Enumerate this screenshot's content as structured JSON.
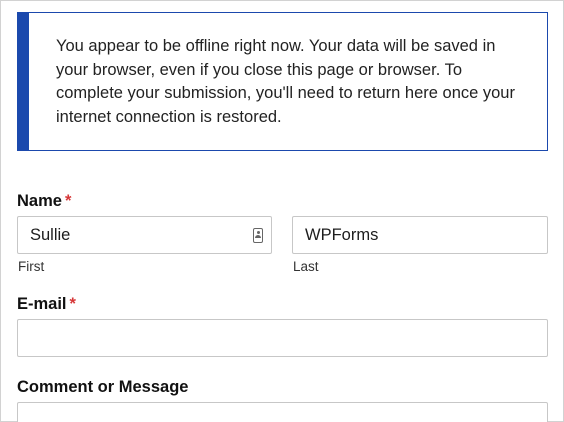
{
  "offline_notice": {
    "message": "You appear to be offline right now. Your data will be saved in your browser, even if you close this page or browser. To complete your submission, you'll need to return here once your internet connection is restored."
  },
  "form": {
    "name": {
      "label": "Name",
      "required_mark": "*",
      "first": {
        "value": "Sullie",
        "sublabel": "First"
      },
      "last": {
        "value": "WPForms",
        "sublabel": "Last"
      }
    },
    "email": {
      "label": "E-mail",
      "required_mark": "*",
      "value": ""
    },
    "comment": {
      "label": "Comment or Message",
      "value": ""
    }
  },
  "colors": {
    "notice_border": "#1b49ad",
    "required": "#d63637"
  }
}
